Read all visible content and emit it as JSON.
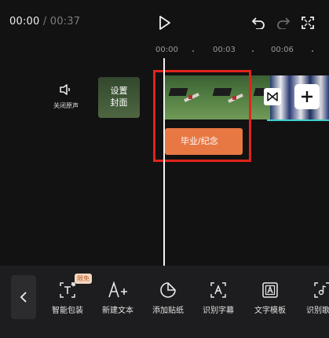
{
  "header": {
    "current_time": "00:00",
    "separator": "/",
    "total_time": "00:37"
  },
  "ruler": {
    "labels": [
      "00:00",
      "00:03",
      "00:06"
    ]
  },
  "left_panel": {
    "mute_label": "关闭原声",
    "cover_label_line1": "设置",
    "cover_label_line2": "封面"
  },
  "text_clip": {
    "label": "毕业/纪念"
  },
  "toolbar": {
    "badge": "限免",
    "items": [
      {
        "label": "智能包装",
        "icon": "smart-package-icon"
      },
      {
        "label": "新建文本",
        "icon": "add-text-icon"
      },
      {
        "label": "添加贴纸",
        "icon": "sticker-icon"
      },
      {
        "label": "识别字幕",
        "icon": "recognize-subtitle-icon"
      },
      {
        "label": "文字模板",
        "icon": "text-template-icon"
      },
      {
        "label": "识别歌",
        "icon": "recognize-lyrics-icon"
      }
    ]
  },
  "colors": {
    "text_clip": "#e87843",
    "highlight_border": "#e0241b",
    "track_accent": "#3fd0cc"
  }
}
